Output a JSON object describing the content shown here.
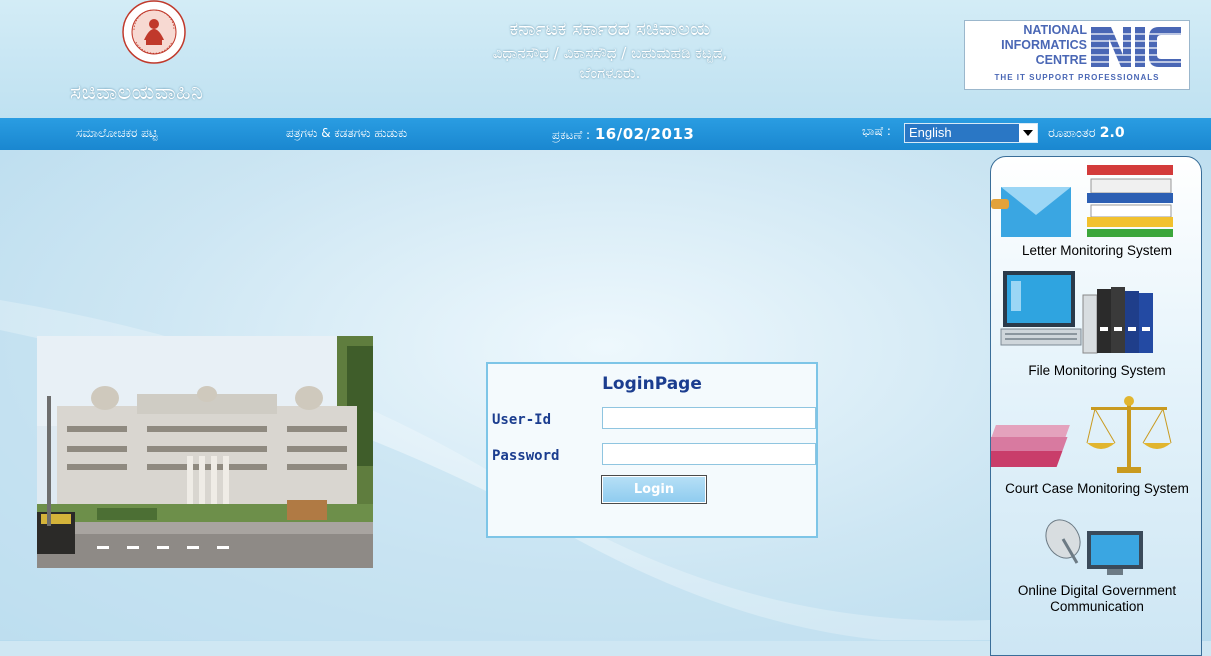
{
  "header": {
    "brand": "ಸಚಿವಾಲಯವಾಹಿನಿ",
    "title_line1": "ಕರ್ನಾಟಕ ಸರ್ಕಾರದ ಸಚಿವಾಲಯ",
    "title_line2": "ವಿಧಾನಸೌಧ / ವಿಕಾಸಸೌಧ / ಬಹುಮಹಡಿ ಕಟ್ಟಡ,",
    "title_line3": "ಬೆಂಗಳೂರು.",
    "emblem_text_top": "GOVERNMENT OF",
    "emblem_text_bottom": "KARNATAKA",
    "nic_line1": "NATIONAL",
    "nic_line2": "INFORMATICS",
    "nic_line3": "CENTRE",
    "nic_tagline": "THE IT SUPPORT PROFESSIONALS"
  },
  "nav": {
    "reviewer_list": "ಸಮಾಲೋಚಕರ ಪಟ್ಟಿ",
    "search_letters_files": "ಪತ್ರಗಳು & ಕಡತಗಳು ಹುಡುಕು",
    "release_label": "ಪ್ರಕಟಣೆ :",
    "release_date": "16/02/2013",
    "language_label": "ಭಾಷೆ :",
    "language_selected": "English",
    "version_label": "ರೂಪಾಂತರ",
    "version_number": "2.0"
  },
  "login": {
    "title": "LoginPage",
    "userid_label": "User-Id",
    "password_label": "Password",
    "userid_value": "",
    "password_value": "",
    "button_label": "Login"
  },
  "sidebar": {
    "items": [
      {
        "label": "Letter Monitoring System"
      },
      {
        "label": "File Monitoring System"
      },
      {
        "label": "Court Case Monitoring System"
      },
      {
        "label": "Online Digital Government Communication"
      }
    ]
  },
  "colors": {
    "nav_blue": "#1a87d0",
    "login_title": "#1b3d8f",
    "nic_blue": "#4a67b5"
  }
}
